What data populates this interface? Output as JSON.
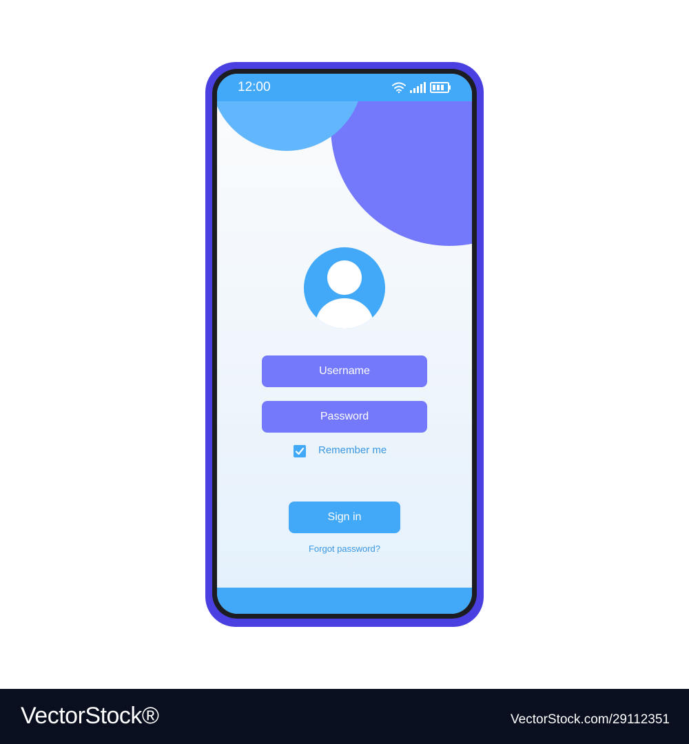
{
  "status_bar": {
    "time": "12:00",
    "icons": [
      "wifi-icon",
      "signal-icon",
      "battery-icon"
    ]
  },
  "login": {
    "avatar_icon": "user-avatar-icon",
    "username_placeholder": "Username",
    "password_placeholder": "Password",
    "remember_label": "Remember me",
    "remember_checked": true,
    "signin_label": "Sign in",
    "forgot_label": "Forgot password?"
  },
  "watermark": {
    "brand": "VectorStock®",
    "id_text": "VectorStock.com/29112351"
  },
  "colors": {
    "phone_frame": "#4a3fe0",
    "accent_blue": "#42a8f8",
    "accent_purple": "#7479fc",
    "light_blue": "#62b6fc",
    "footer_bg": "#0a0f1f"
  }
}
